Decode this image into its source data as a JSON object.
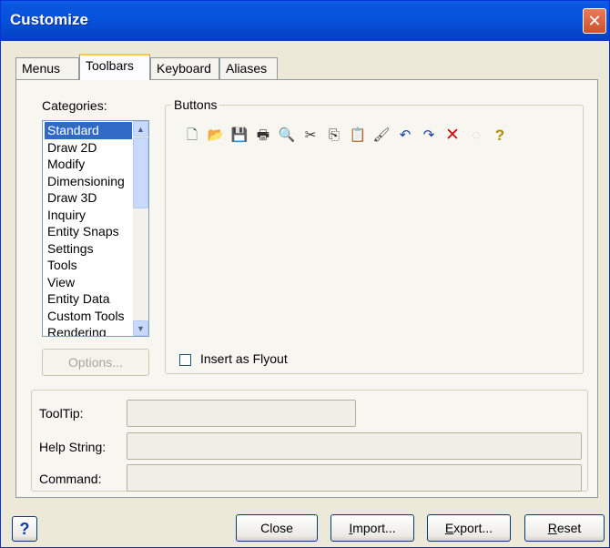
{
  "window": {
    "title": "Customize",
    "close_glyph": "✕"
  },
  "tabs": [
    {
      "label": "Menus",
      "active": false
    },
    {
      "label": "Toolbars",
      "active": true
    },
    {
      "label": "Keyboard",
      "active": false
    },
    {
      "label": "Aliases",
      "active": false
    }
  ],
  "categories": {
    "label": "Categories:",
    "selected": "Standard",
    "items": [
      "Standard",
      "Draw 2D",
      "Modify",
      "Dimensioning",
      "Draw 3D",
      "Inquiry",
      "Entity Snaps",
      "Settings",
      "Tools",
      "View",
      "Entity Data",
      "Custom Tools",
      "Rendering"
    ]
  },
  "options_button": {
    "label": "Options...",
    "enabled": false
  },
  "buttons_group": {
    "legend": "Buttons",
    "icons": [
      {
        "name": "new-icon",
        "glyph": "🗋",
        "color": "#3a6d3a"
      },
      {
        "name": "open-folder-icon",
        "glyph": "📂",
        "color": "#b08a1a"
      },
      {
        "name": "save-icon",
        "glyph": "💾",
        "color": "#222222"
      },
      {
        "name": "print-icon",
        "glyph": "🖶",
        "color": "#333333"
      },
      {
        "name": "print-preview-icon",
        "glyph": "🔍",
        "color": "#1c4fa0"
      },
      {
        "name": "cut-icon",
        "glyph": "✂",
        "color": "#333333"
      },
      {
        "name": "copy-icon",
        "glyph": "⎘",
        "color": "#333333"
      },
      {
        "name": "paste-icon",
        "glyph": "📋",
        "color": "#7a5a20"
      },
      {
        "name": "match-properties-icon",
        "glyph": "🖌",
        "color": "#444444"
      },
      {
        "name": "undo-icon",
        "glyph": "↶",
        "color": "#1c3f9a"
      },
      {
        "name": "redo-icon",
        "glyph": "↷",
        "color": "#1c3f9a"
      },
      {
        "name": "delete-icon",
        "glyph": "✕",
        "color": "#cc1010"
      },
      {
        "name": "disabled-tool-icon",
        "glyph": "◌",
        "color": "#c8c8c0"
      },
      {
        "name": "help-icon",
        "glyph": "?",
        "color": "#b08a00"
      }
    ],
    "insert_flyout": {
      "label": "Insert as Flyout",
      "checked": false
    }
  },
  "fields": {
    "tooltip": {
      "label": "ToolTip:",
      "value": ""
    },
    "help_string": {
      "label": "Help String:",
      "value": ""
    },
    "command": {
      "label": "Command:",
      "value": ""
    }
  },
  "footer": {
    "help_glyph": "?",
    "close": "Close",
    "import_pre": "",
    "import_u": "I",
    "import_post": "mport...",
    "export_pre": "",
    "export_u": "E",
    "export_post": "xport...",
    "reset_pre": "",
    "reset_u": "R",
    "reset_post": "eset"
  }
}
